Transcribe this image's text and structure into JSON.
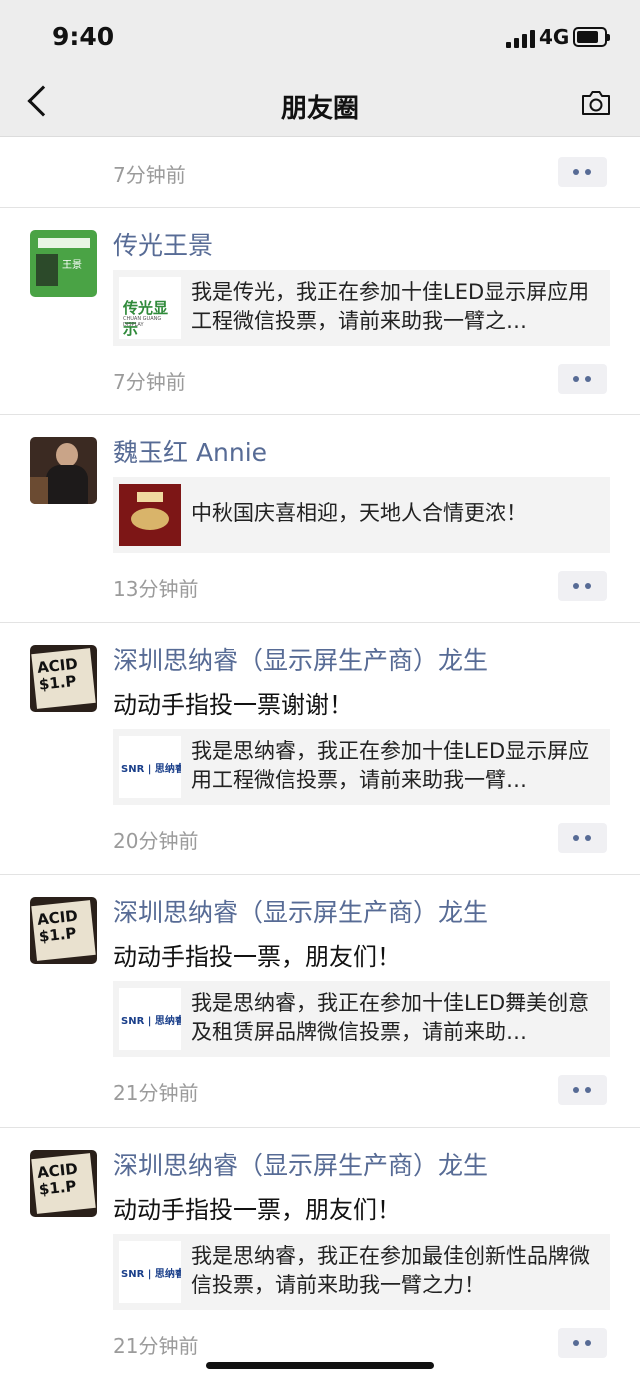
{
  "status_bar": {
    "time": "9:40",
    "network": "4G",
    "battery_level": 0.8
  },
  "nav": {
    "title": "朋友圈",
    "back_icon": "chevron-left-icon",
    "camera_icon": "camera-icon"
  },
  "top_partial": {
    "timestamp": "7分钟前"
  },
  "moments": [
    {
      "name": "传光王景",
      "text": "",
      "link_text": "我是传光，我正在参加十佳LED显示屏应用工程微信投票，请前来助我一臂之…",
      "link_logo_text": "传光显示",
      "link_logo_subtext": "CHUAN GUANG DISPLAY",
      "avatar_text": "王景",
      "timestamp": "7分钟前"
    },
    {
      "name": "魏玉红 Annie",
      "text": "",
      "link_text": "中秋国庆喜相迎，天地人合情更浓！",
      "timestamp": "13分钟前"
    },
    {
      "name": "深圳思纳睿（显示屏生产商）龙生",
      "text": "动动手指投一票谢谢！",
      "link_text": "我是思纳睿，我正在参加十佳LED显示屏应用工程微信投票，请前来助我一臂…",
      "link_logo_text": "SNR | 思纳睿",
      "avatar_text": "ACID $1.P",
      "timestamp": "20分钟前"
    },
    {
      "name": "深圳思纳睿（显示屏生产商）龙生",
      "text": "动动手指投一票，朋友们！",
      "link_text": "我是思纳睿，我正在参加十佳LED舞美创意及租赁屏品牌微信投票，请前来助…",
      "link_logo_text": "SNR | 思纳睿",
      "avatar_text": "ACID $1.P",
      "timestamp": "21分钟前"
    },
    {
      "name": "深圳思纳睿（显示屏生产商）龙生",
      "text": "动动手指投一票，朋友们！",
      "link_text": "我是思纳睿，我正在参加最佳创新性品牌微信投票，请前来助我一臂之力！",
      "link_logo_text": "SNR | 思纳睿",
      "avatar_text": "ACID $1.P",
      "timestamp": "21分钟前"
    }
  ],
  "colors": {
    "nickname": "#576b95",
    "background": "#ffffff",
    "card": "#f3f3f3",
    "navbar": "#ededed"
  }
}
